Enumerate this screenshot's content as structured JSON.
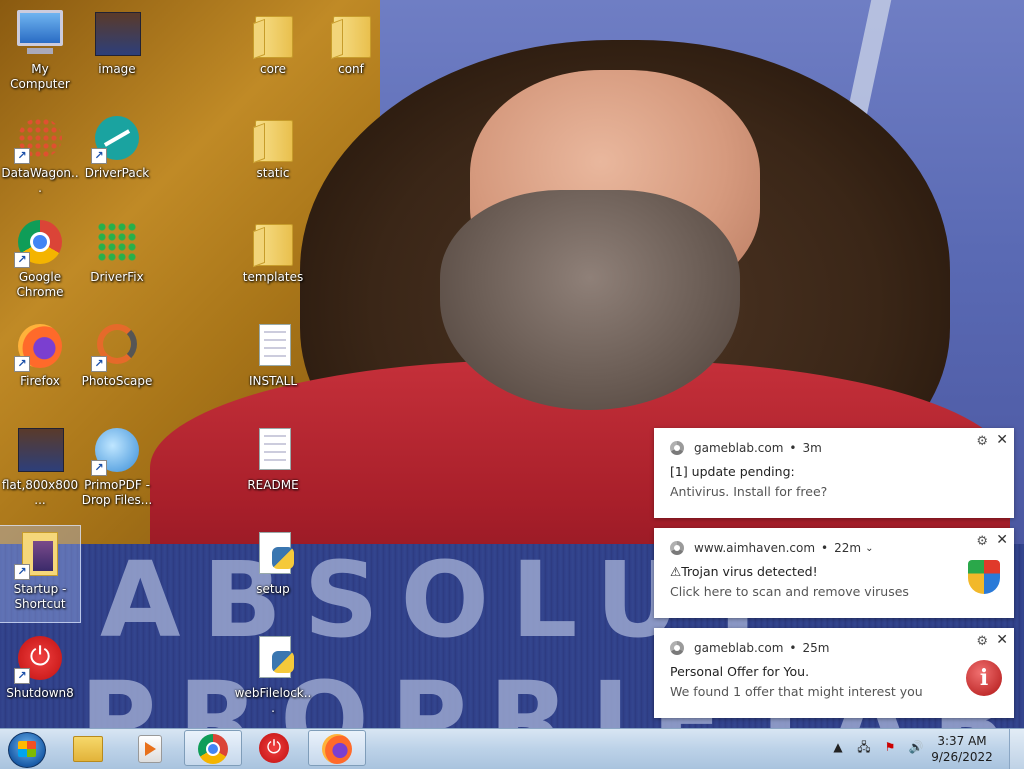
{
  "desktop": {
    "icons": [
      {
        "label": "My Computer"
      },
      {
        "label": "image"
      },
      {
        "label": "core"
      },
      {
        "label": "conf"
      },
      {
        "label": "DataWagon..."
      },
      {
        "label": "DriverPack"
      },
      {
        "label": "static"
      },
      {
        "label": "Google Chrome"
      },
      {
        "label": "DriverFix"
      },
      {
        "label": "templates"
      },
      {
        "label": "Firefox"
      },
      {
        "label": "PhotoScape"
      },
      {
        "label": "INSTALL"
      },
      {
        "label": "flat,800x800..."
      },
      {
        "label": "PrimoPDF - Drop Files..."
      },
      {
        "label": "README"
      },
      {
        "label": "Startup - Shortcut"
      },
      {
        "label": "setup"
      },
      {
        "label": "Shutdown8"
      },
      {
        "label": "webFilelock..."
      }
    ],
    "wallpaper_text_1": "ABSOLUT",
    "wallpaper_text_2": "PROPRIETARY"
  },
  "notifications": [
    {
      "source": "gameblab.com",
      "age": "3m",
      "title": "[1] update pending:",
      "body": "Antivirus. Install for free?",
      "icon": "none"
    },
    {
      "source": "www.aimhaven.com",
      "age": "22m",
      "title": "⚠Trojan virus detected!",
      "body": "Click here to scan and remove viruses",
      "icon": "shield-icon"
    },
    {
      "source": "gameblab.com",
      "age": "25m",
      "title": "Personal Offer for You.",
      "body": "We found 1 offer that might interest you",
      "icon": "info-icon"
    }
  ],
  "taskbar": {
    "pinned": [
      "windows-explorer",
      "media-player",
      "google-chrome",
      "shutdown",
      "firefox"
    ],
    "clock": {
      "time": "3:37 AM",
      "date": "9/26/2022"
    },
    "tray_glyphs": {
      "expand": "▲",
      "network": "🖧",
      "flag": "⚑",
      "volume": "🔊"
    }
  },
  "colors": {
    "taskbar_top": "#d8e6f3",
    "taskbar_bottom": "#a9c3de",
    "notification_bg": "#ffffff"
  }
}
